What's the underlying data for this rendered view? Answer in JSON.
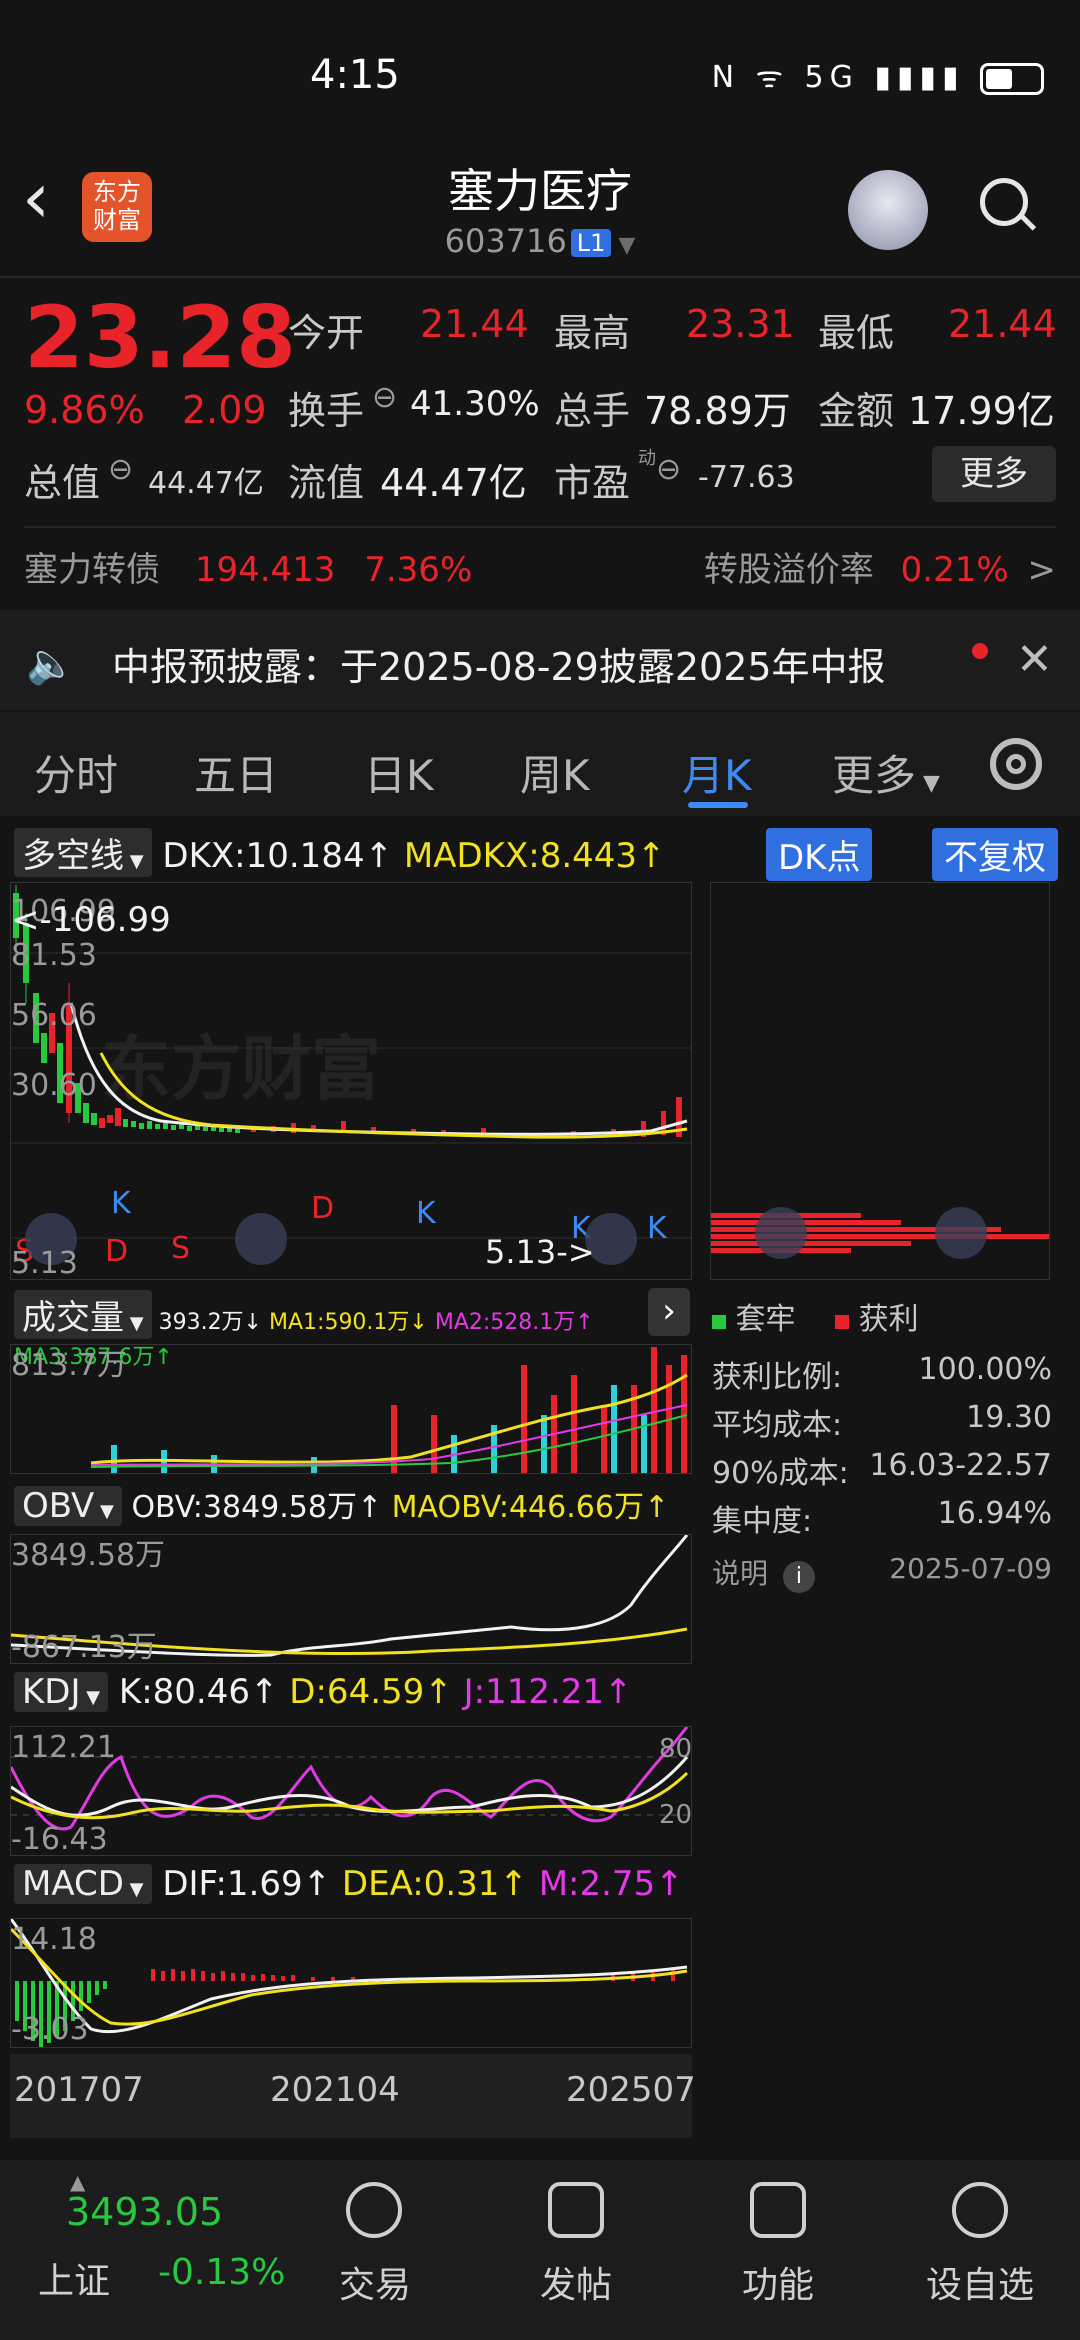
{
  "status_bar": {
    "time": "4:15",
    "icons": "N  ᯤ 5G  ▮▮▮▮"
  },
  "header": {
    "back_icon": "‹",
    "logo_text": "东方财富",
    "title": "塞力医疗",
    "code": "603716",
    "level_badge": "L1"
  },
  "quote": {
    "price": "23.28",
    "change_pct": "9.86%",
    "change": "2.09",
    "open_label": "今开",
    "open": "21.44",
    "high_label": "最高",
    "high": "23.31",
    "low_label": "最低",
    "low": "21.44",
    "turnover_label": "换手",
    "turnover": "41.30%",
    "volume_label": "总手",
    "volume": "78.89万",
    "amount_label": "金额",
    "amount": "17.99亿",
    "mktcap_label": "总值",
    "mktcap": "44.47亿",
    "float_label": "流值",
    "float_cap": "44.47亿",
    "pe_label": "市盈",
    "pe_sup": "动",
    "pe": "-77.63",
    "more_label": "更多"
  },
  "bond": {
    "name": "塞力转债",
    "price": "194.413",
    "pct": "7.36%",
    "premium_label": "转股溢价率",
    "premium": "0.21%",
    "chevron": ">"
  },
  "notice": {
    "text": "中报预披露：于2025-08-29披露2025年中报"
  },
  "tabs": [
    "分时",
    "五日",
    "日K",
    "周K",
    "月K",
    "更多"
  ],
  "active_tab": "月K",
  "colors": {
    "up": "#e8232a",
    "down": "#27c93f",
    "accent": "#3d8bf2"
  },
  "main_chart": {
    "indicator": "多空线",
    "dkx": "DKX:10.184↑",
    "madkx": "MADKX:8.443↑",
    "dk_button": "DK点",
    "fq_button": "不复权",
    "labels": {
      "top": "106.99",
      "top_marker": "<-106.99",
      "l2": "81.53",
      "l3": "56.06",
      "l4": "30.60",
      "bottom": "5.13",
      "bottom_marker": "5.13->"
    },
    "watermark": "东方财富"
  },
  "volume_chart": {
    "indicator": "成交量",
    "vol": "393.2万↓",
    "ma1": "MA1:590.1万↓",
    "ma2": "MA2:528.1万↑",
    "ma3": "MA3:387.6万↑",
    "max_label": "813.7万"
  },
  "obv_chart": {
    "indicator": "OBV",
    "obv": "OBV:3849.58万↑",
    "maobv": "MAOBV:446.66万↑",
    "top": "3849.58万",
    "bottom": "-867.13万"
  },
  "kdj_chart": {
    "indicator": "KDJ",
    "k": "K:80.46↑",
    "d": "D:64.59↑",
    "j": "J:112.21↑",
    "top": "112.21",
    "bottom": "-16.43",
    "r1": "80",
    "r2": "20"
  },
  "macd_chart": {
    "indicator": "MACD",
    "dif": "DIF:1.69↑",
    "dea": "DEA:0.31↑",
    "m": "M:2.75↑",
    "top": "14.18",
    "bottom": "-3.03"
  },
  "x_axis": [
    "201707",
    "202104",
    "202507"
  ],
  "chip": {
    "legend_trapped": "套牢",
    "legend_profit": "获利",
    "rows": [
      {
        "k": "获利比例:",
        "v": "100.00%"
      },
      {
        "k": "平均成本:",
        "v": "19.30"
      },
      {
        "k": "90%成本:",
        "v": "16.03-22.57"
      },
      {
        "k": "集中度:",
        "v": "16.94%"
      }
    ],
    "note_label": "说明",
    "date": "2025-07-09"
  },
  "bottom_nav": {
    "index_value": "3493.05",
    "index_name": "上证",
    "index_change": "-0.13%",
    "items": [
      "交易",
      "发帖",
      "功能",
      "设自选"
    ]
  }
}
